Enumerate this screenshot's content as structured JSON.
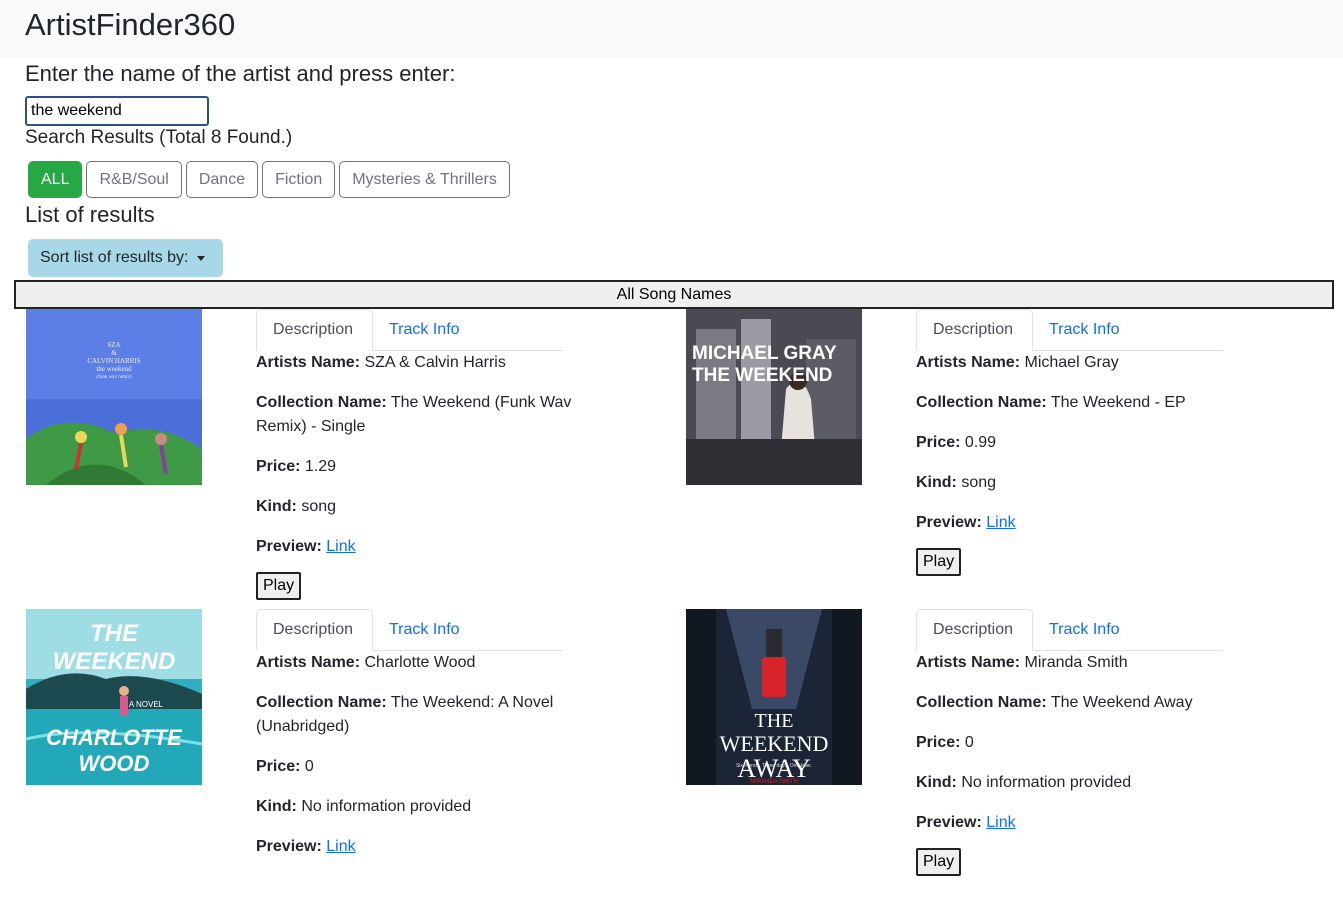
{
  "app": {
    "title": "ArtistFinder360"
  },
  "search": {
    "prompt": "Enter the name of the artist and press enter:",
    "value": "the weekend"
  },
  "results": {
    "summary": "Search Results (Total 8 Found.)"
  },
  "filters": [
    "ALL",
    "R&B/Soul",
    "Dance",
    "Fiction",
    "Mysteries & Thrillers"
  ],
  "list": {
    "title": "List of results",
    "sort_label": "Sort list of results by:",
    "all_songs_label": "All Song Names"
  },
  "labels": {
    "tab_description": "Description",
    "tab_track_info": "Track Info",
    "artist": "Artists Name:",
    "collection": "Collection Name:",
    "price": "Price:",
    "kind": "Kind:",
    "preview": "Preview:",
    "link": "Link",
    "play": "Play"
  },
  "items": [
    {
      "artist": "SZA & Calvin Harris",
      "collection": "The Weekend (Funk Wav Remix) - Single",
      "price": "1.29",
      "kind": "song",
      "cover_lines": [
        "SZA",
        "&",
        "CALVIN HARRIS",
        "the weekend",
        "(funk wav remix)"
      ]
    },
    {
      "artist": "Michael Gray",
      "collection": "The Weekend - EP",
      "price": "0.99",
      "kind": "song",
      "cover_lines": [
        "MICHAEL GRAY",
        "THE WEEKEND"
      ]
    },
    {
      "artist": "Charlotte Wood",
      "collection": "The Weekend: A Novel (Unabridged)",
      "price": "0",
      "kind": "No information provided",
      "cover_lines": [
        "THE",
        "WEEKEND",
        "A NOVEL",
        "CHARLOTTE",
        "WOOD"
      ]
    },
    {
      "artist": "Miranda Smith",
      "collection": "The Weekend Away",
      "price": "0",
      "kind": "No information provided",
      "cover_lines": [
        "THE",
        "WEEKEND",
        "AWAY",
        "Six friends. Three days. One killer.",
        "MIRANDA SMITH"
      ]
    }
  ],
  "colors": {
    "filter_active": "#28a745",
    "sort_button": "#a8d8e8",
    "link": "#0d6efd",
    "navbar": "#f8f9fa"
  }
}
